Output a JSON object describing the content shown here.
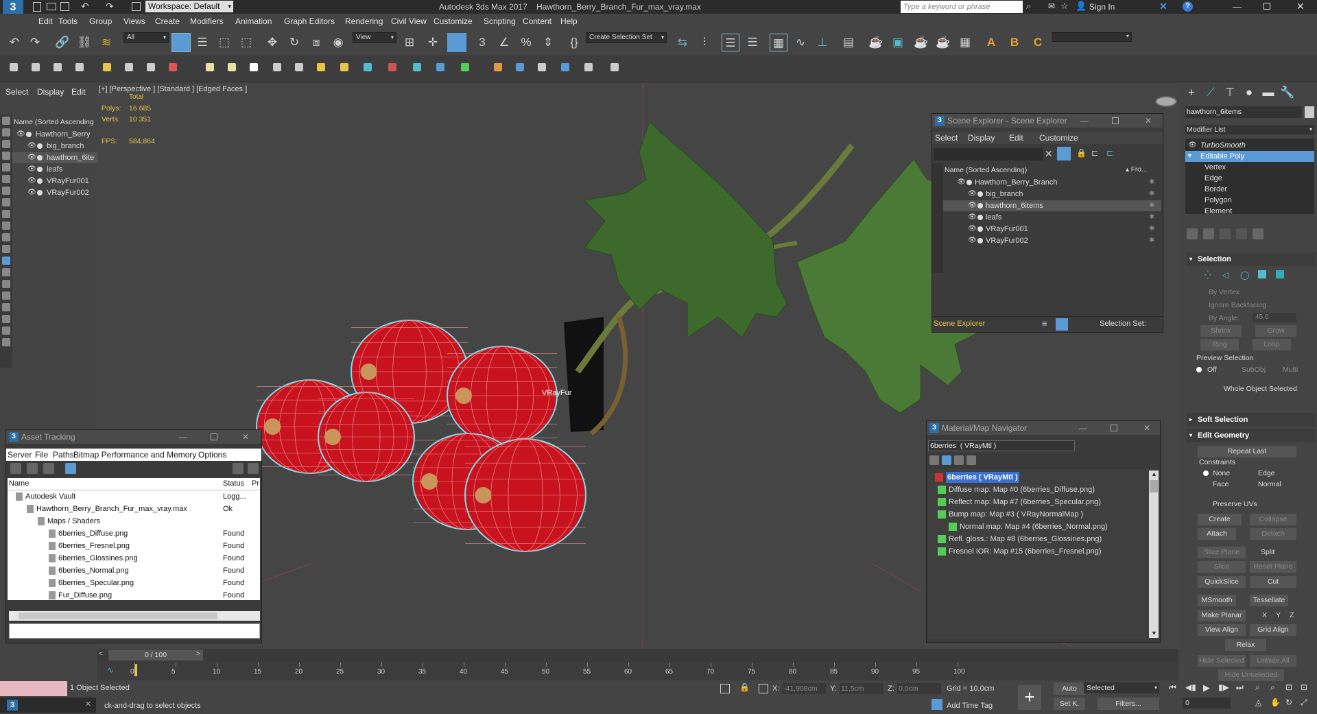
{
  "window": {
    "title": "Autodesk 3ds Max 2017    Hawthorn_Berry_Branch_Fur_max_vray.max",
    "workspace": "Workspace: Default",
    "search_placeholder": "Type a keyword or phrase",
    "sign_in": "Sign In"
  },
  "menu": [
    "Edit",
    "Tools",
    "Group",
    "Views",
    "Create",
    "Modifiers",
    "Animation",
    "Graph Editors",
    "Rendering",
    "Civil View",
    "Customize",
    "Scripting",
    "Content",
    "Help"
  ],
  "toolbar": {
    "filter": "All",
    "view": "View",
    "selection_set": "Create Selection Set"
  },
  "left_menu": [
    "Select",
    "Display",
    "Edit"
  ],
  "viewport": {
    "label": "[+] [Perspective ] [Standard ] [Edged Faces ]",
    "stats_header": "Total",
    "polys_label": "Polys:",
    "polys": "16 685",
    "verts_label": "Verts:",
    "verts": "10 351",
    "fps_label": "FPS:",
    "fps": "584,864",
    "fur_label": "VRayFur"
  },
  "scene_tree": {
    "header": "Name (Sorted Ascending",
    "items": [
      "Hawthorn_Berry",
      "big_branch",
      "hawthorn_6ite",
      "leafs",
      "VRayFur001",
      "VRayFur002"
    ]
  },
  "scene_explorer": {
    "title": "Scene Explorer - Scene Explorer",
    "menu": [
      "Select",
      "Display",
      "Edit",
      "Customize"
    ],
    "header": "Name (Sorted Ascending)",
    "header_right": "▴ Fro...",
    "items": [
      "Hawthorn_Berry_Branch",
      "big_branch",
      "hawthorn_6items",
      "leafs",
      "VRayFur001",
      "VRayFur002"
    ],
    "footer_left": "Scene Explorer",
    "footer_right": "Selection Set:"
  },
  "asset_tracking": {
    "title": "Asset Tracking",
    "menu": [
      "Server",
      "File",
      "Paths",
      "Bitmap Performance and Memory",
      "Options"
    ],
    "col_name": "Name",
    "col_status": "Status",
    "col_p": "Pr",
    "rows": [
      {
        "name": "Autodesk Vault",
        "status": "Logg..."
      },
      {
        "name": "Hawthorn_Berry_Branch_Fur_max_vray.max",
        "status": "Ok"
      },
      {
        "name": "Maps / Shaders",
        "status": ""
      },
      {
        "name": "6berries_Diffuse.png",
        "status": "Found"
      },
      {
        "name": "6berries_Fresnel.png",
        "status": "Found"
      },
      {
        "name": "6berries_Glossines.png",
        "status": "Found"
      },
      {
        "name": "6berries_Normal.png",
        "status": "Found"
      },
      {
        "name": "6berries_Specular.png",
        "status": "Found"
      },
      {
        "name": "Fur_Diffuse.png",
        "status": "Found"
      }
    ]
  },
  "material_nav": {
    "title": "Material/Map Navigator",
    "field": "6berries  ( VRayMtl )",
    "items": [
      "6berries  ( VRayMtl )",
      "Diffuse map: Map #0 (6berries_Diffuse.png)",
      "Reflect map: Map #7 (6berries_Specular.png)",
      "Bump map: Map #3  ( VRayNormalMap )",
      "Normal map: Map #4 (6berries_Normal.png)",
      "Refl. gloss.: Map #8 (6berries_Glossines.png)",
      "Fresnel IOR: Map #15 (6berries_Fresnel.png)"
    ]
  },
  "command_panel": {
    "object_name": "hawthorn_6items",
    "modifier_list": "Modifier List",
    "stack": [
      "TurboSmooth",
      "Editable Poly",
      "Vertex",
      "Edge",
      "Border",
      "Polygon",
      "Element"
    ],
    "selection": {
      "title": "Selection",
      "by_vertex": "By Vertex",
      "ignore_backfacing": "Ignore Backfacing",
      "by_angle": "By Angle:",
      "angle": "45,0",
      "shrink": "Shrink",
      "grow": "Grow",
      "ring": "Ring",
      "loop": "Loop",
      "preview": "Preview Selection",
      "off": "Off",
      "subobj": "SubObj",
      "multi": "Multi",
      "status": "Whole Object Selected"
    },
    "soft_selection": "Soft Selection",
    "edit_geometry": {
      "title": "Edit Geometry",
      "repeat_last": "Repeat Last",
      "constraints": "Constraints",
      "none": "None",
      "edge": "Edge",
      "face": "Face",
      "normal": "Normal",
      "preserve_uvs": "Preserve UVs",
      "create": "Create",
      "collapse": "Collapse",
      "attach": "Attach",
      "detach": "Detach",
      "slice_plane": "Slice Plane",
      "split": "Split",
      "slice": "Slice",
      "reset_plane": "Reset Plane",
      "quickslice": "QuickSlice",
      "cut": "Cut",
      "msmooth": "MSmooth",
      "tessellate": "Tessellate",
      "make_planar": "Make Planar",
      "x": "X",
      "y": "Y",
      "z": "Z",
      "view_align": "View Align",
      "grid_align": "Grid Align",
      "relax": "Relax",
      "hide_selected": "Hide Selected",
      "unhide_all": "Unhide All",
      "hide_unselected": "Hide Unselected"
    }
  },
  "timeline": {
    "frame": "0 / 100",
    "ticks": [
      "0",
      "5",
      "10",
      "15",
      "20",
      "25",
      "30",
      "35",
      "40",
      "45",
      "50",
      "55",
      "60",
      "65",
      "70",
      "75",
      "80",
      "85",
      "90",
      "95",
      "100"
    ]
  },
  "status": {
    "selected": "1 Object Selected",
    "prompt": "ck-and-drag to select objects",
    "x_label": "X:",
    "x": "-41,908cm",
    "y_label": "Y:",
    "y": "11,5cm",
    "z_label": "Z:",
    "z": "0,0cm",
    "grid": "Grid = 10,0cm",
    "add_time_tag": "Add Time Tag",
    "auto": "Auto",
    "set_k": "Set K.",
    "selected_dd": "Selected",
    "filters": "Filters...",
    "frame_field": "0"
  }
}
